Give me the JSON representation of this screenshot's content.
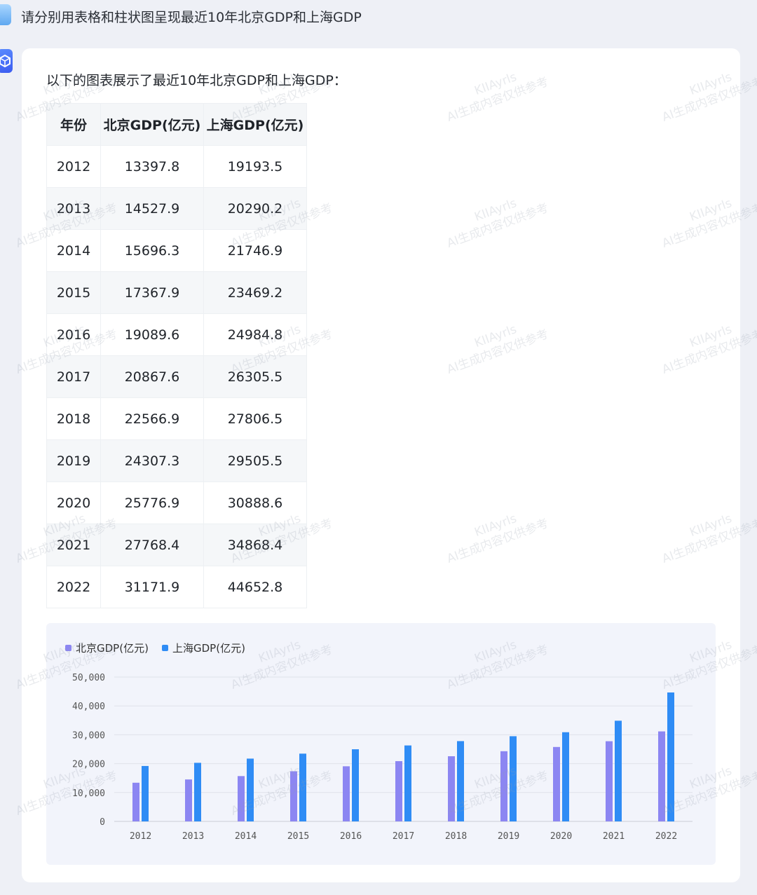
{
  "question": "请分别用表格和柱状图呈现最近10年北京GDP和上海GDP",
  "answer": {
    "intro": "以下的图表展示了最近10年北京GDP和上海GDP："
  },
  "table": {
    "headers": [
      "年份",
      "北京GDP(亿元)",
      "上海GDP(亿元)"
    ],
    "rows": [
      [
        "2012",
        "13397.8",
        "19193.5"
      ],
      [
        "2013",
        "14527.9",
        "20290.2"
      ],
      [
        "2014",
        "15696.3",
        "21746.9"
      ],
      [
        "2015",
        "17367.9",
        "23469.2"
      ],
      [
        "2016",
        "19089.6",
        "24984.8"
      ],
      [
        "2017",
        "20867.6",
        "26305.5"
      ],
      [
        "2018",
        "22566.9",
        "27806.5"
      ],
      [
        "2019",
        "24307.3",
        "29505.5"
      ],
      [
        "2020",
        "25776.9",
        "30888.6"
      ],
      [
        "2021",
        "27768.4",
        "34868.4"
      ],
      [
        "2022",
        "31171.9",
        "44652.8"
      ]
    ]
  },
  "chart_data": {
    "type": "bar",
    "categories": [
      "2012",
      "2013",
      "2014",
      "2015",
      "2016",
      "2017",
      "2018",
      "2019",
      "2020",
      "2021",
      "2022"
    ],
    "series": [
      {
        "name": "北京GDP(亿元)",
        "color": "#8c86f2",
        "values": [
          13397.8,
          14527.9,
          15696.3,
          17367.9,
          19089.6,
          20867.6,
          22566.9,
          24307.3,
          25776.9,
          27768.4,
          31171.9
        ]
      },
      {
        "name": "上海GDP(亿元)",
        "color": "#2f8cf5",
        "values": [
          19193.5,
          20290.2,
          21746.9,
          23469.2,
          24984.8,
          26305.5,
          27806.5,
          29505.5,
          30888.6,
          34868.4,
          44652.8
        ]
      }
    ],
    "y_ticks": [
      "0",
      "10,000",
      "20,000",
      "30,000",
      "40,000",
      "50,000"
    ],
    "ylim": [
      0,
      50000
    ],
    "grid": true,
    "legend": "top-left"
  },
  "watermark": {
    "line1": "KIIAyrls",
    "line2": "AI生成内容仅供参考"
  }
}
